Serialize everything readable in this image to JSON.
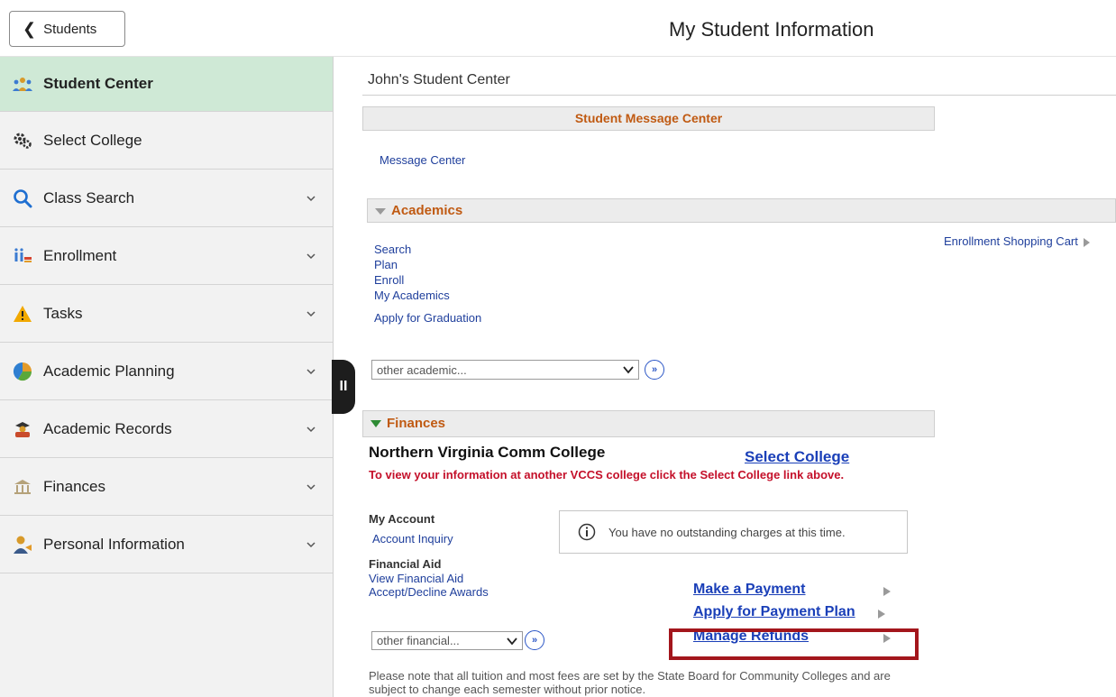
{
  "header": {
    "back_label": "Students",
    "title": "My Student Information"
  },
  "sidebar": {
    "items": [
      {
        "label": "Student Center",
        "icon": "student-center-icon",
        "active": true
      },
      {
        "label": "Select College",
        "icon": "gears-icon"
      },
      {
        "label": "Class Search",
        "icon": "magnifier-icon"
      },
      {
        "label": "Enrollment",
        "icon": "enrollment-icon"
      },
      {
        "label": "Tasks",
        "icon": "warning-icon"
      },
      {
        "label": "Academic Planning",
        "icon": "pie-chart-icon"
      },
      {
        "label": "Academic Records",
        "icon": "records-icon"
      },
      {
        "label": "Finances",
        "icon": "bank-icon"
      },
      {
        "label": "Personal Information",
        "icon": "person-icon"
      }
    ],
    "collapse_glyph": "II"
  },
  "main": {
    "center_title": "John's Student Center",
    "message_center": {
      "bar_label": "Student Message Center",
      "link": "Message Center"
    },
    "academics": {
      "bar_label": "Academics",
      "links": [
        "Search",
        "Plan",
        "Enroll",
        "My Academics"
      ],
      "graduation_link": "Apply for Graduation",
      "cart_link": "Enrollment Shopping Cart",
      "select_value": "other academic..."
    },
    "finances": {
      "bar_label": "Finances",
      "college_name": "Northern Virginia Comm College",
      "select_college_link": "Select College",
      "note": "To view your information at another VCCS college click the Select College link above.",
      "my_account_label": "My Account",
      "account_inquiry_link": "Account Inquiry",
      "financial_aid_label": "Financial Aid",
      "aid_links": [
        "View Financial Aid",
        "Accept/Decline Awards"
      ],
      "charges_message": "You have no outstanding charges at this time.",
      "payment_links": [
        "Make a Payment",
        "Apply for Payment Plan",
        "Manage Refunds"
      ],
      "select_value": "other financial...",
      "footnote": "Please note that all tuition and most fees are set by the State Board for Community Colleges and are subject to change each semester without prior notice."
    }
  },
  "colors": {
    "active_nav": "#cfe9d6",
    "bar_text": "#c05a12",
    "link": "#1f3f9c",
    "note_red": "#c4102a",
    "highlight": "#a3161c"
  }
}
